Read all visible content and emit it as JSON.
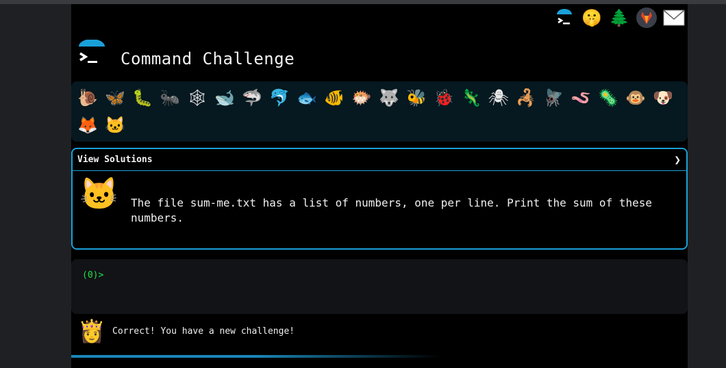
{
  "app": {
    "title": "Command Challenge"
  },
  "top_icons": [
    {
      "name": "command-challenge-logo-icon",
      "glyph": "≻"
    },
    {
      "name": "shushing-face-icon",
      "glyph": "🤫"
    },
    {
      "name": "evergreen-tree-icon",
      "glyph": "🌲"
    },
    {
      "name": "gitlab-icon",
      "glyph": "🦊"
    },
    {
      "name": "mail-icon",
      "glyph": "✉"
    }
  ],
  "animals": [
    {
      "name": "snail-icon",
      "glyph": "🐌"
    },
    {
      "name": "butterfly-icon",
      "glyph": "🦋"
    },
    {
      "name": "caterpillar-icon",
      "glyph": "🐛"
    },
    {
      "name": "ant-icon",
      "glyph": "🐜"
    },
    {
      "name": "spider-web-icon",
      "glyph": "🕸"
    },
    {
      "name": "whale-icon",
      "glyph": "🐋"
    },
    {
      "name": "shark-icon",
      "glyph": "🦈"
    },
    {
      "name": "dolphin-icon",
      "glyph": "🐬"
    },
    {
      "name": "fish-icon",
      "glyph": "🐟"
    },
    {
      "name": "tropical-fish-icon",
      "glyph": "🐠"
    },
    {
      "name": "blowfish-icon",
      "glyph": "🐡"
    },
    {
      "name": "wolf-icon",
      "glyph": "🐺"
    },
    {
      "name": "bee-icon",
      "glyph": "🐝"
    },
    {
      "name": "ladybug-icon",
      "glyph": "🐞"
    },
    {
      "name": "lizard-icon",
      "glyph": "🦎"
    },
    {
      "name": "spider-icon",
      "glyph": "🕷"
    },
    {
      "name": "scorpion-icon",
      "glyph": "🦂"
    },
    {
      "name": "fly-icon",
      "glyph": "🪰"
    },
    {
      "name": "worm-icon",
      "glyph": "🪱"
    },
    {
      "name": "microbe-icon",
      "glyph": "🦠"
    },
    {
      "name": "monkey-face-icon",
      "glyph": "🐵"
    },
    {
      "name": "dog-face-icon",
      "glyph": "🐶"
    },
    {
      "name": "fox-face-icon",
      "glyph": "🦊"
    },
    {
      "name": "cat-face-icon",
      "glyph": "🐱"
    }
  ],
  "solutions": {
    "label": "View Solutions",
    "chevron": "❯"
  },
  "challenge": {
    "avatar": "🐱",
    "text": "The file sum-me.txt has a list of numbers, one per line. Print the sum of these numbers."
  },
  "terminal": {
    "prompt": "(0)>"
  },
  "status": {
    "avatar": "👸",
    "text": "Correct! You have a new challenge!"
  },
  "progress": {
    "fraction": 0.5
  },
  "colors": {
    "accent": "#1aa0d8",
    "prompt": "#22e04a",
    "animal_bar_bg": "#061820"
  }
}
